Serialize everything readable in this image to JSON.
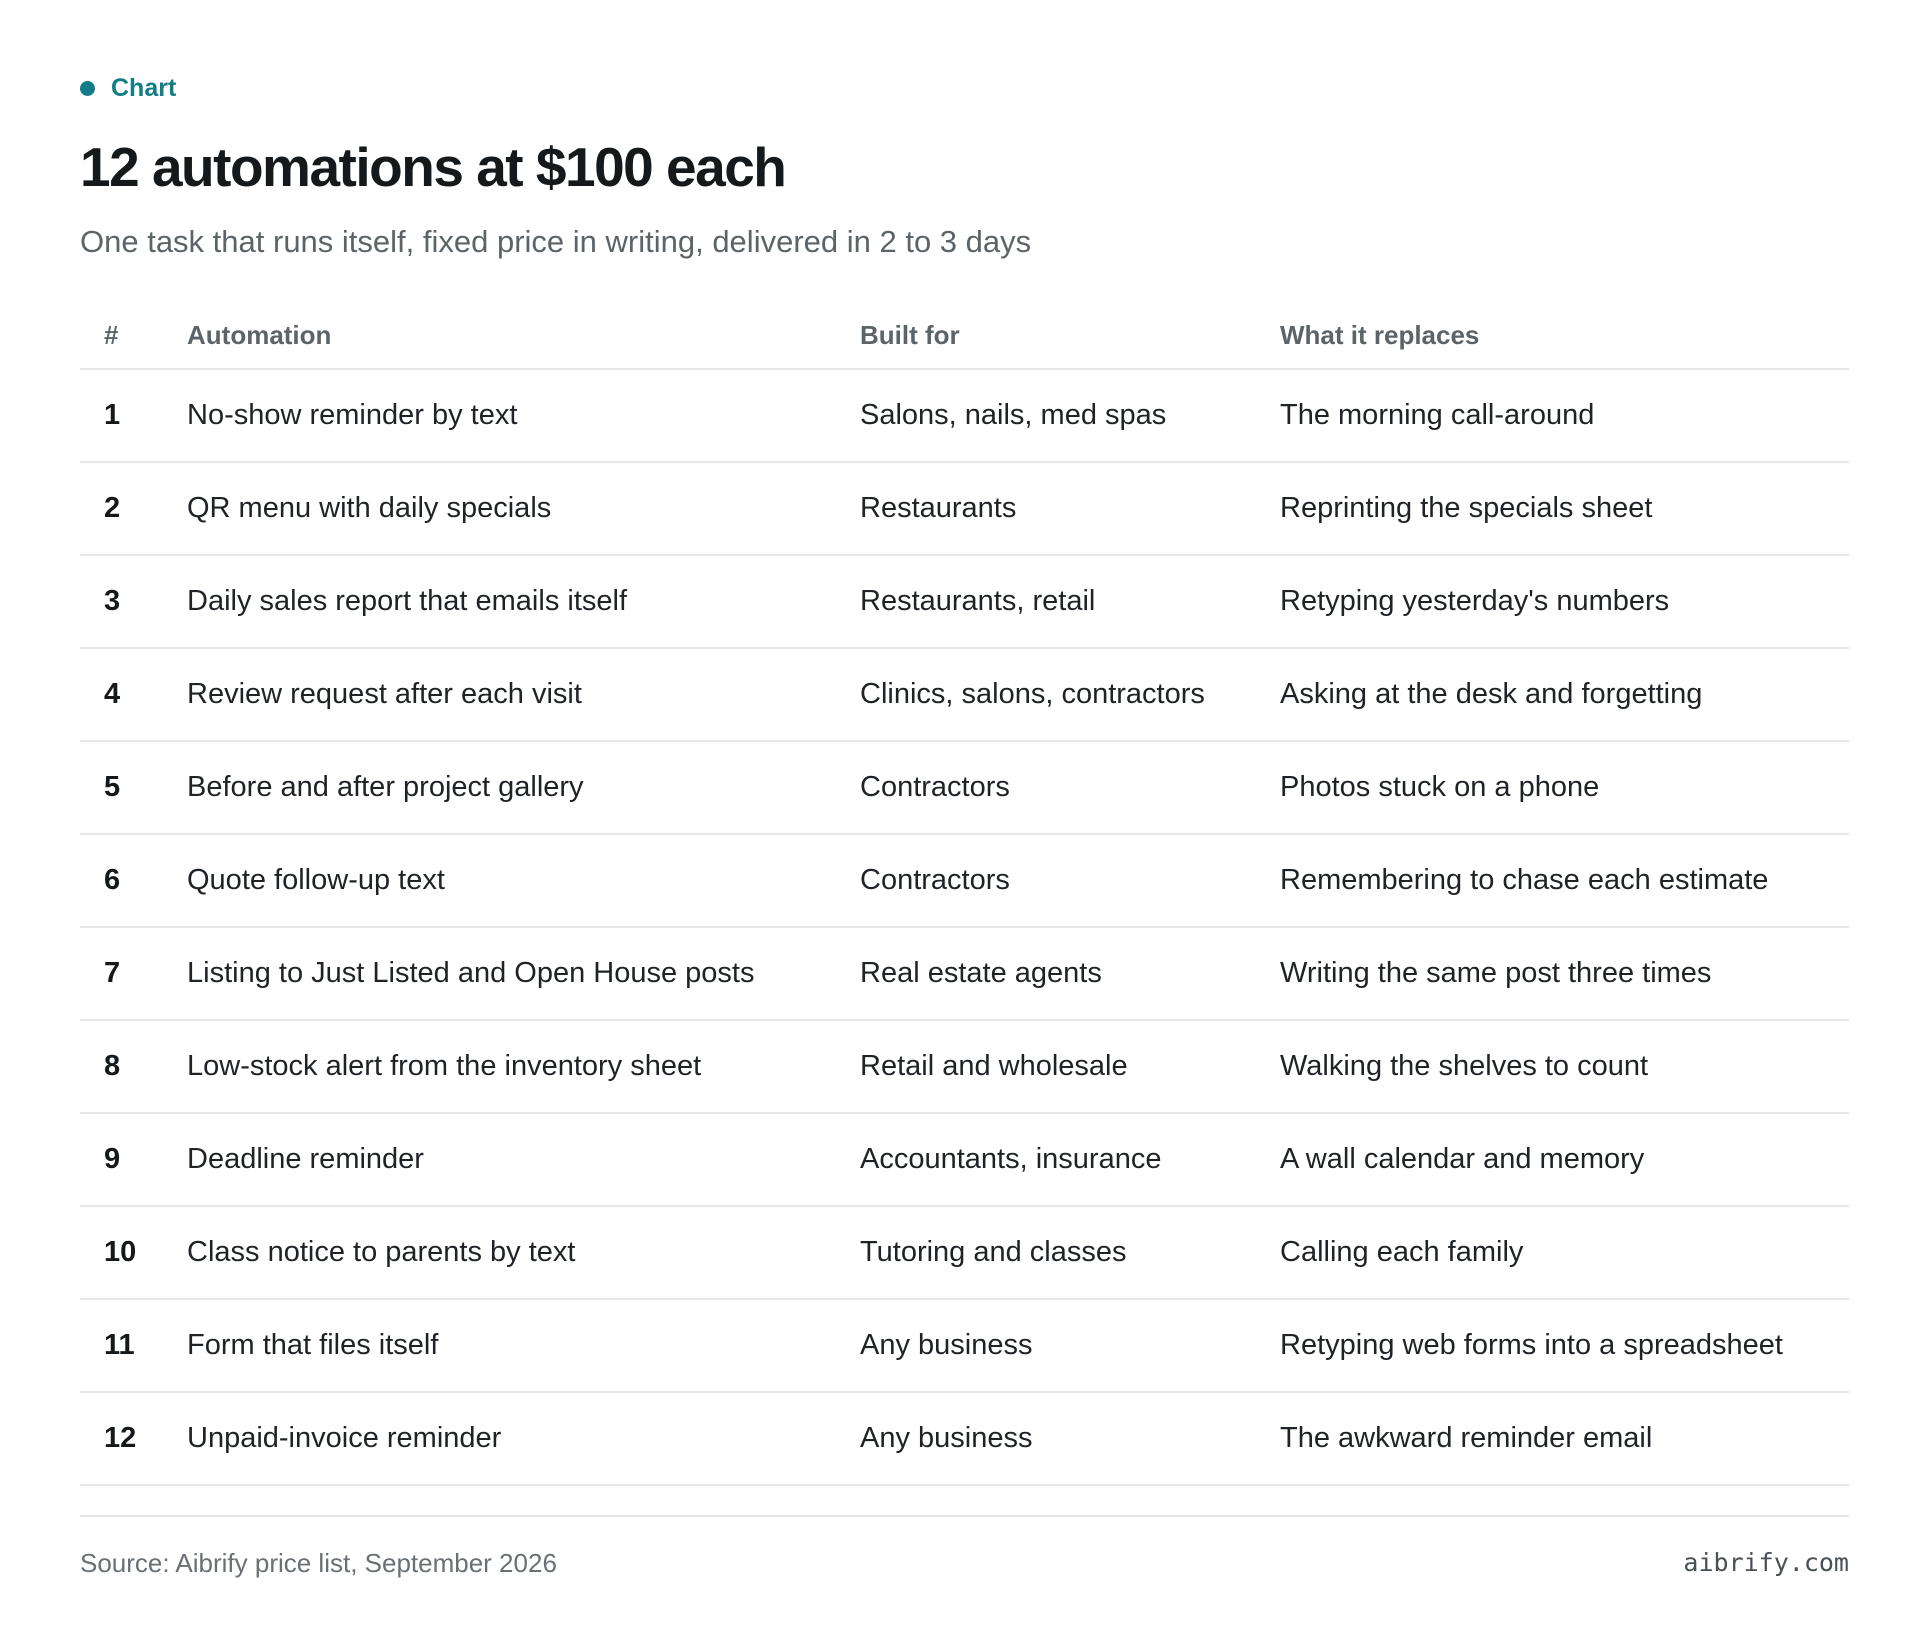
{
  "eyebrow": "Chart",
  "title": "12 automations at $100 each",
  "subtitle": "One task that runs itself, fixed price in writing, delivered in 2 to 3 days",
  "chart_data": {
    "type": "table",
    "columns": [
      "#",
      "Automation",
      "Built for",
      "What it replaces"
    ],
    "rows": [
      [
        "1",
        "No-show reminder by text",
        "Salons, nails, med spas",
        "The morning call-around"
      ],
      [
        "2",
        "QR menu with daily specials",
        "Restaurants",
        "Reprinting the specials sheet"
      ],
      [
        "3",
        "Daily sales report that emails itself",
        "Restaurants, retail",
        "Retyping yesterday's numbers"
      ],
      [
        "4",
        "Review request after each visit",
        "Clinics, salons, contractors",
        "Asking at the desk and forgetting"
      ],
      [
        "5",
        "Before and after project gallery",
        "Contractors",
        "Photos stuck on a phone"
      ],
      [
        "6",
        "Quote follow-up text",
        "Contractors",
        "Remembering to chase each estimate"
      ],
      [
        "7",
        "Listing to Just Listed and Open House posts",
        "Real estate agents",
        "Writing the same post three times"
      ],
      [
        "8",
        "Low-stock alert from the inventory sheet",
        "Retail and wholesale",
        "Walking the shelves to count"
      ],
      [
        "9",
        "Deadline reminder",
        "Accountants, insurance",
        "A wall calendar and memory"
      ],
      [
        "10",
        "Class notice to parents by text",
        "Tutoring and classes",
        "Calling each family"
      ],
      [
        "11",
        "Form that files itself",
        "Any business",
        "Retyping web forms into a spreadsheet"
      ],
      [
        "12",
        "Unpaid-invoice reminder",
        "Any business",
        "The awkward reminder email"
      ]
    ]
  },
  "footer": {
    "source": "Source: Aibrify price list, September 2026",
    "brand": "aibrify.com"
  },
  "colors": {
    "accent": "#137c86",
    "title": "#15191c",
    "muted": "#5d6469",
    "rule": "#e3e5e7"
  }
}
